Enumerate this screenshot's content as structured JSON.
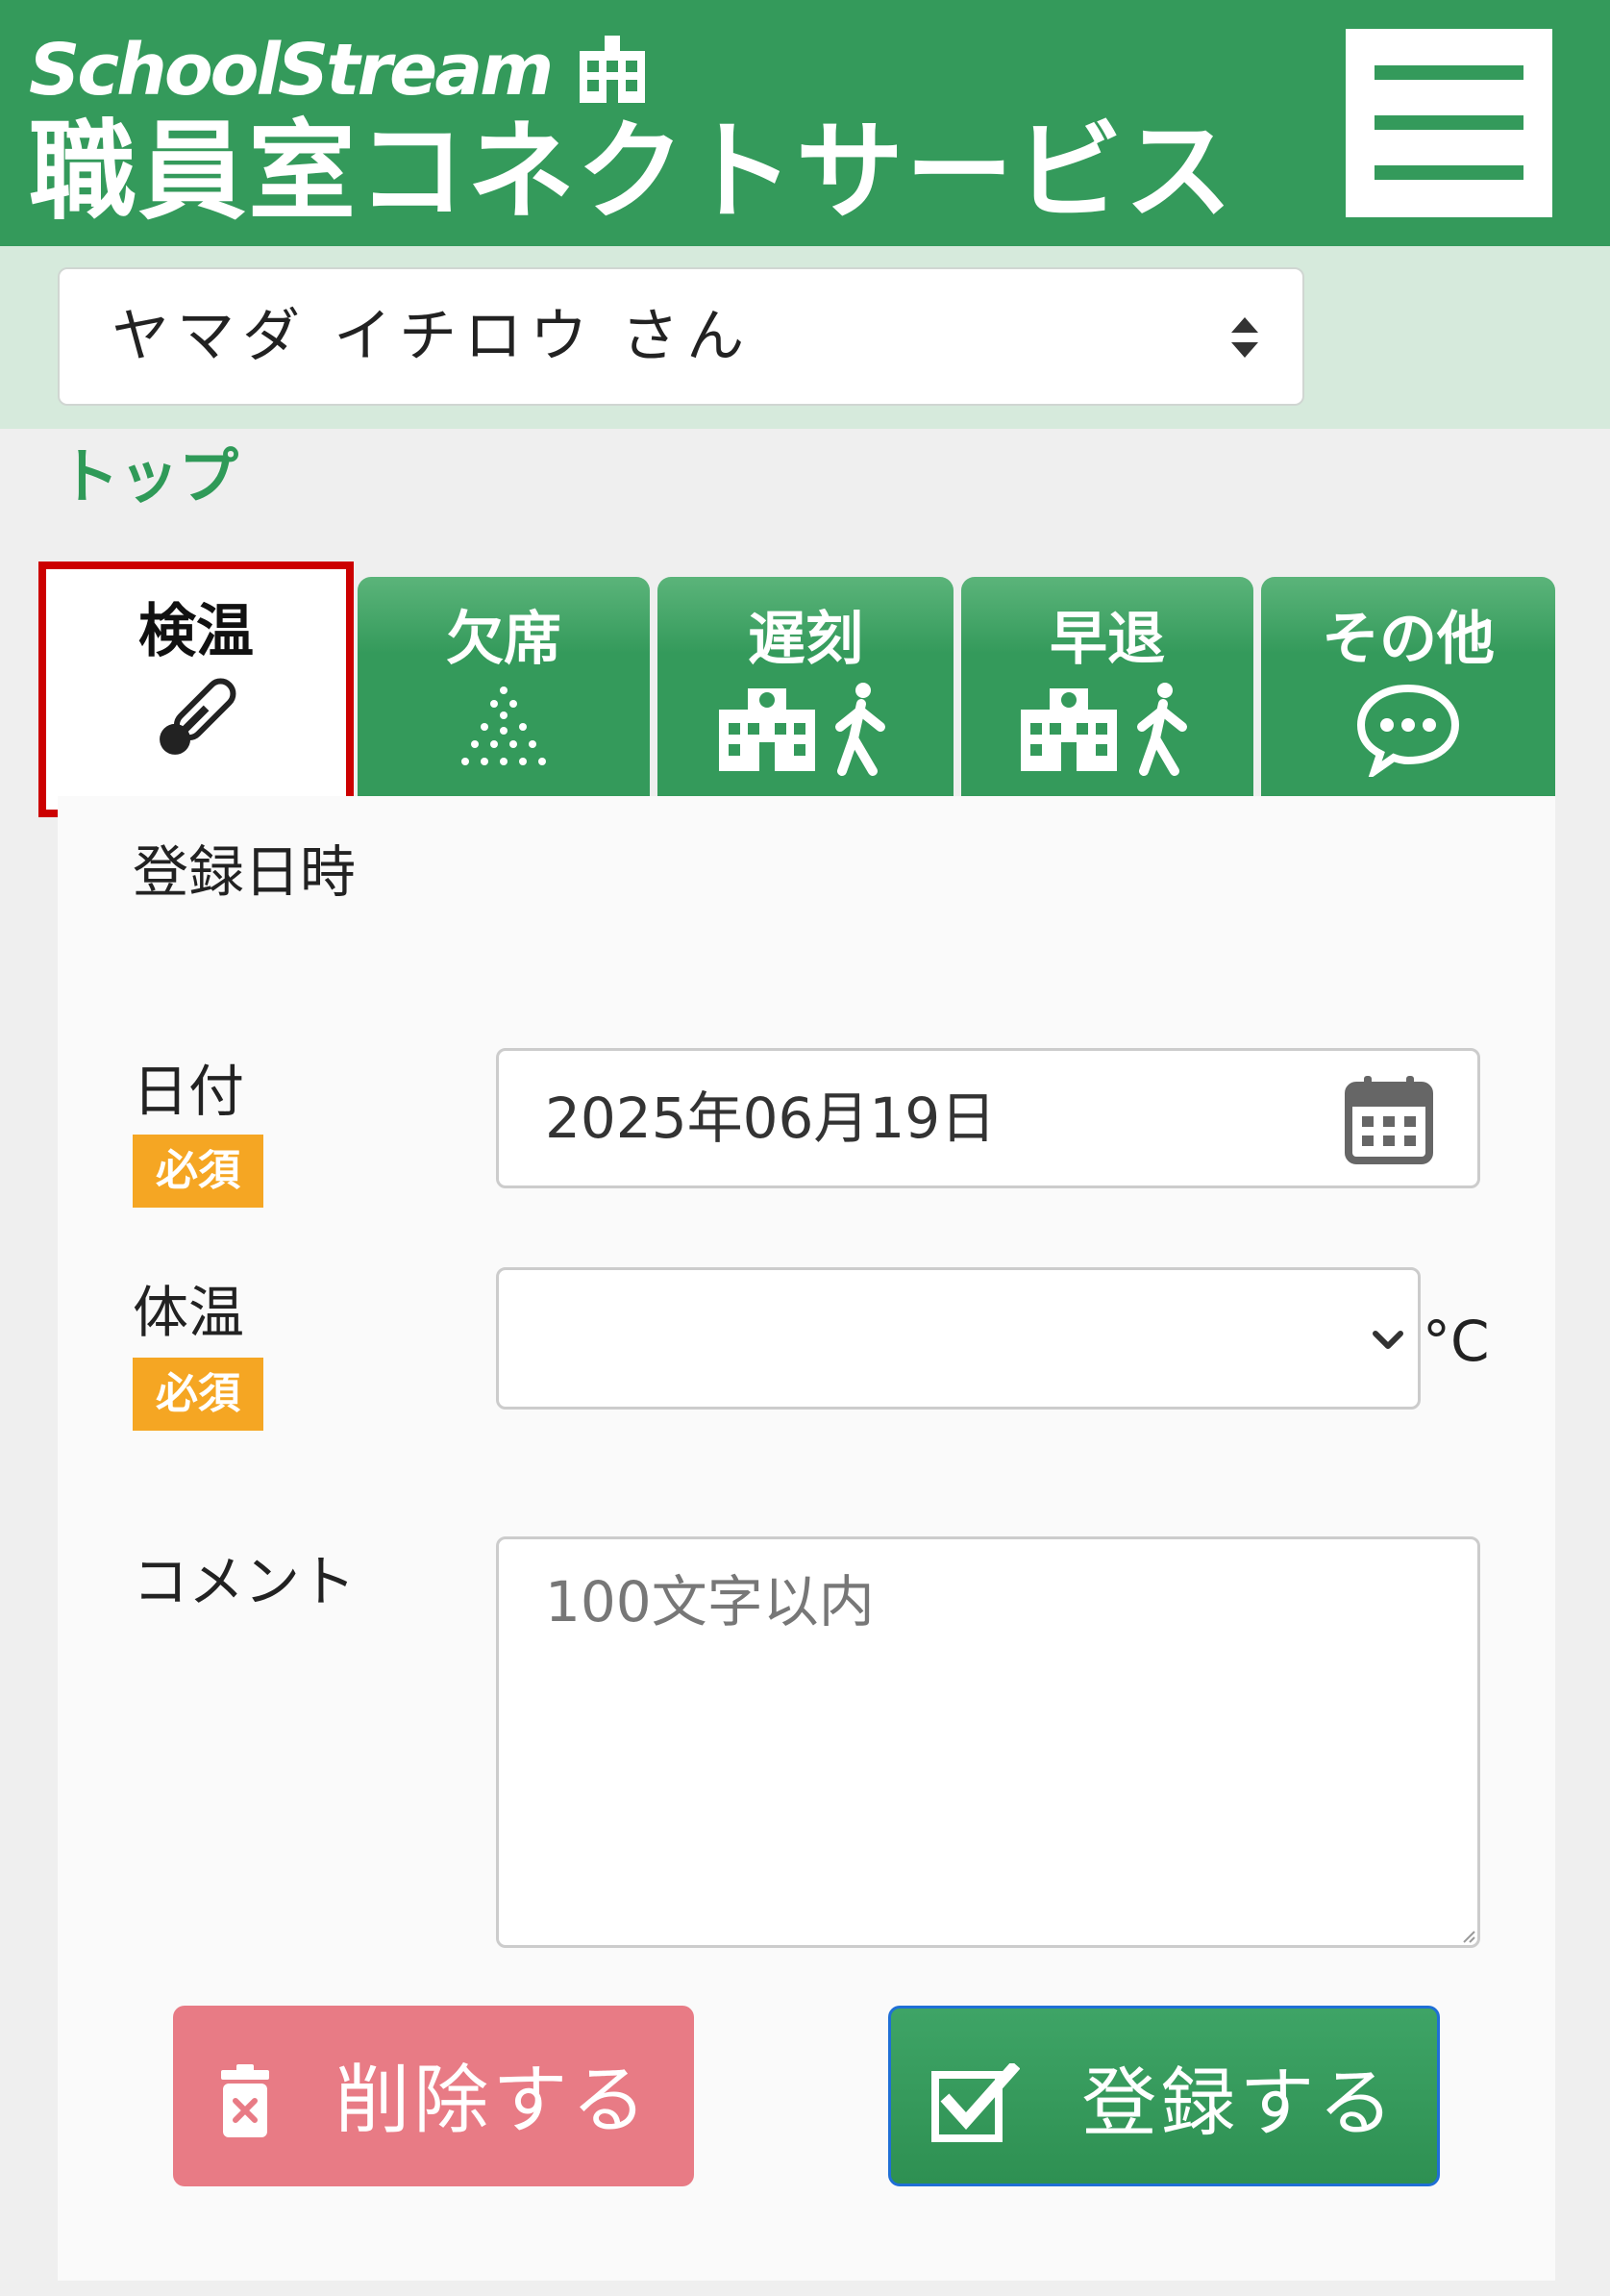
{
  "header": {
    "brand_en": "SchoolStream",
    "brand_jp": "職員室コネクトサービス"
  },
  "user_select": {
    "value": "ヤマダ イチロウ さん"
  },
  "breadcrumb": "トップ",
  "tabs": [
    {
      "label": "検温",
      "icon": "thermometer-icon",
      "active": true
    },
    {
      "label": "欠席",
      "icon": "absence-dots-icon",
      "active": false
    },
    {
      "label": "遅刻",
      "icon": "school-walk-icon",
      "active": false
    },
    {
      "label": "早退",
      "icon": "school-walk-icon",
      "active": false
    },
    {
      "label": "その他",
      "icon": "chat-bubble-icon",
      "active": false
    }
  ],
  "form": {
    "section_title": "登録日時",
    "date": {
      "label": "日付",
      "required": "必須",
      "value": "2025年06月19日"
    },
    "temperature": {
      "label": "体温",
      "required": "必須",
      "value": "",
      "unit": "°C"
    },
    "comment": {
      "label": "コメント",
      "placeholder": "100文字以内"
    }
  },
  "buttons": {
    "delete": "削除する",
    "register": "登録する"
  },
  "colors": {
    "brand_green": "#349a5b",
    "light_green": "#d6eadc",
    "required_badge": "#f5a623",
    "delete_button": "#e87b85",
    "active_tab_outline": "#cc0000"
  }
}
